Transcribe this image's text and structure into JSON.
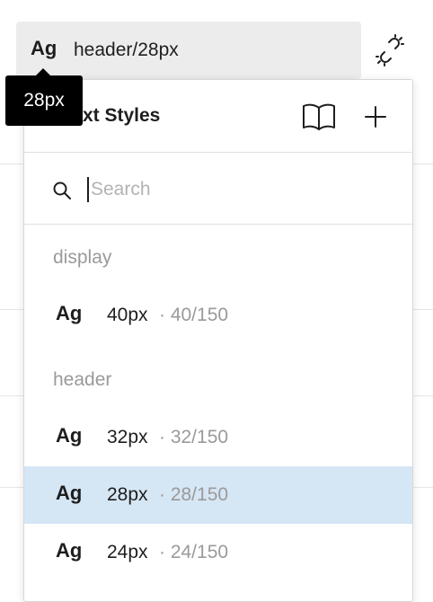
{
  "field": {
    "preview": "Ag",
    "style_name": "header/28px"
  },
  "tooltip": {
    "text": "28px"
  },
  "panel": {
    "title": "Text Styles",
    "search_placeholder": "Search",
    "groups": [
      {
        "label": "display",
        "items": [
          {
            "preview": "Ag",
            "name": "40px",
            "meta": "· 40/150",
            "selected": false
          }
        ]
      },
      {
        "label": "header",
        "items": [
          {
            "preview": "Ag",
            "name": "32px",
            "meta": "· 32/150",
            "selected": false
          },
          {
            "preview": "Ag",
            "name": "28px",
            "meta": "· 28/150",
            "selected": true
          },
          {
            "preview": "Ag",
            "name": "24px",
            "meta": "· 24/150",
            "selected": false
          }
        ]
      }
    ]
  },
  "icons": {
    "detach": "detach-style-icon",
    "library": "book-icon",
    "add": "plus-icon",
    "search": "search-icon"
  },
  "colors": {
    "selected_row": "#d5e6f4",
    "tooltip_bg": "#000000",
    "field_bg": "#ececec"
  }
}
